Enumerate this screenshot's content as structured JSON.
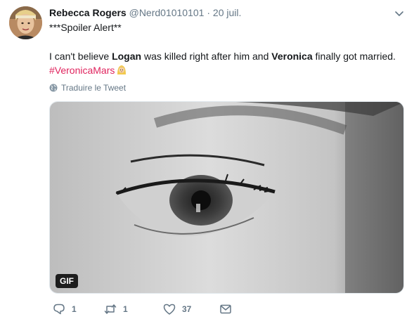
{
  "tweet": {
    "author_name": "Rebecca Rogers",
    "handle": "@Nerd01010101",
    "separator": "·",
    "time": "20 juil.",
    "spoiler_line": "***Spoiler Alert**",
    "text_part1": "I can't believe ",
    "text_bold1": "Logan",
    "text_part2": " was killed right after him and ",
    "text_bold2": "Veronica",
    "text_part3": " finally got married.",
    "hashtag": "#VeronicaMars",
    "translate_label": "Traduire le Tweet",
    "media_badge": "GIF"
  },
  "actions": {
    "reply_count": "1",
    "retweet_count": "1",
    "like_count": "37"
  },
  "icons": {
    "reply": "reply-icon",
    "retweet": "retweet-icon",
    "like": "heart-icon",
    "dm": "envelope-icon",
    "globe": "globe-icon",
    "caret": "chevron-down-icon"
  },
  "colors": {
    "hashtag": "#e0245e",
    "secondary_text": "#657786",
    "primary_text": "#14171a"
  }
}
